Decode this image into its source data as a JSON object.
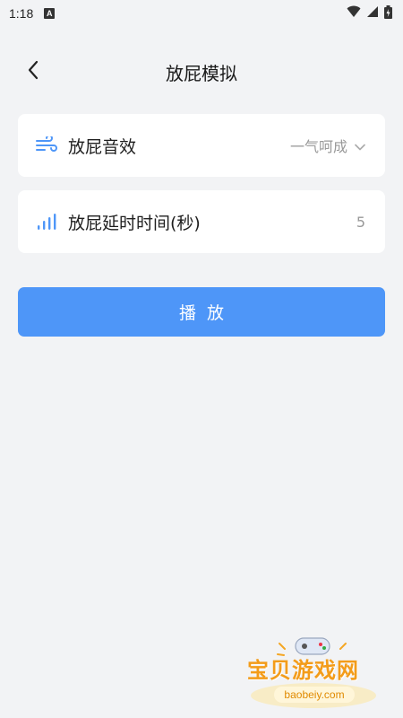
{
  "status_bar": {
    "time": "1:18",
    "notification_icon": "A"
  },
  "header": {
    "title": "放屁模拟"
  },
  "settings": {
    "sound": {
      "label": "放屁音效",
      "value": "一气呵成"
    },
    "delay": {
      "label": "放屁延时时间(秒)",
      "value": "5"
    }
  },
  "actions": {
    "play_label": "播放"
  },
  "watermark": {
    "brand": "宝贝游戏网",
    "url": "baobeiy.com"
  },
  "colors": {
    "background": "#f2f3f5",
    "accent": "#4e96f8",
    "watermark": "#f39c1a"
  },
  "icons": {
    "back": "chevron-left-icon",
    "sound": "wind-icon",
    "delay": "signal-bars-icon",
    "dropdown": "chevron-down-icon"
  }
}
